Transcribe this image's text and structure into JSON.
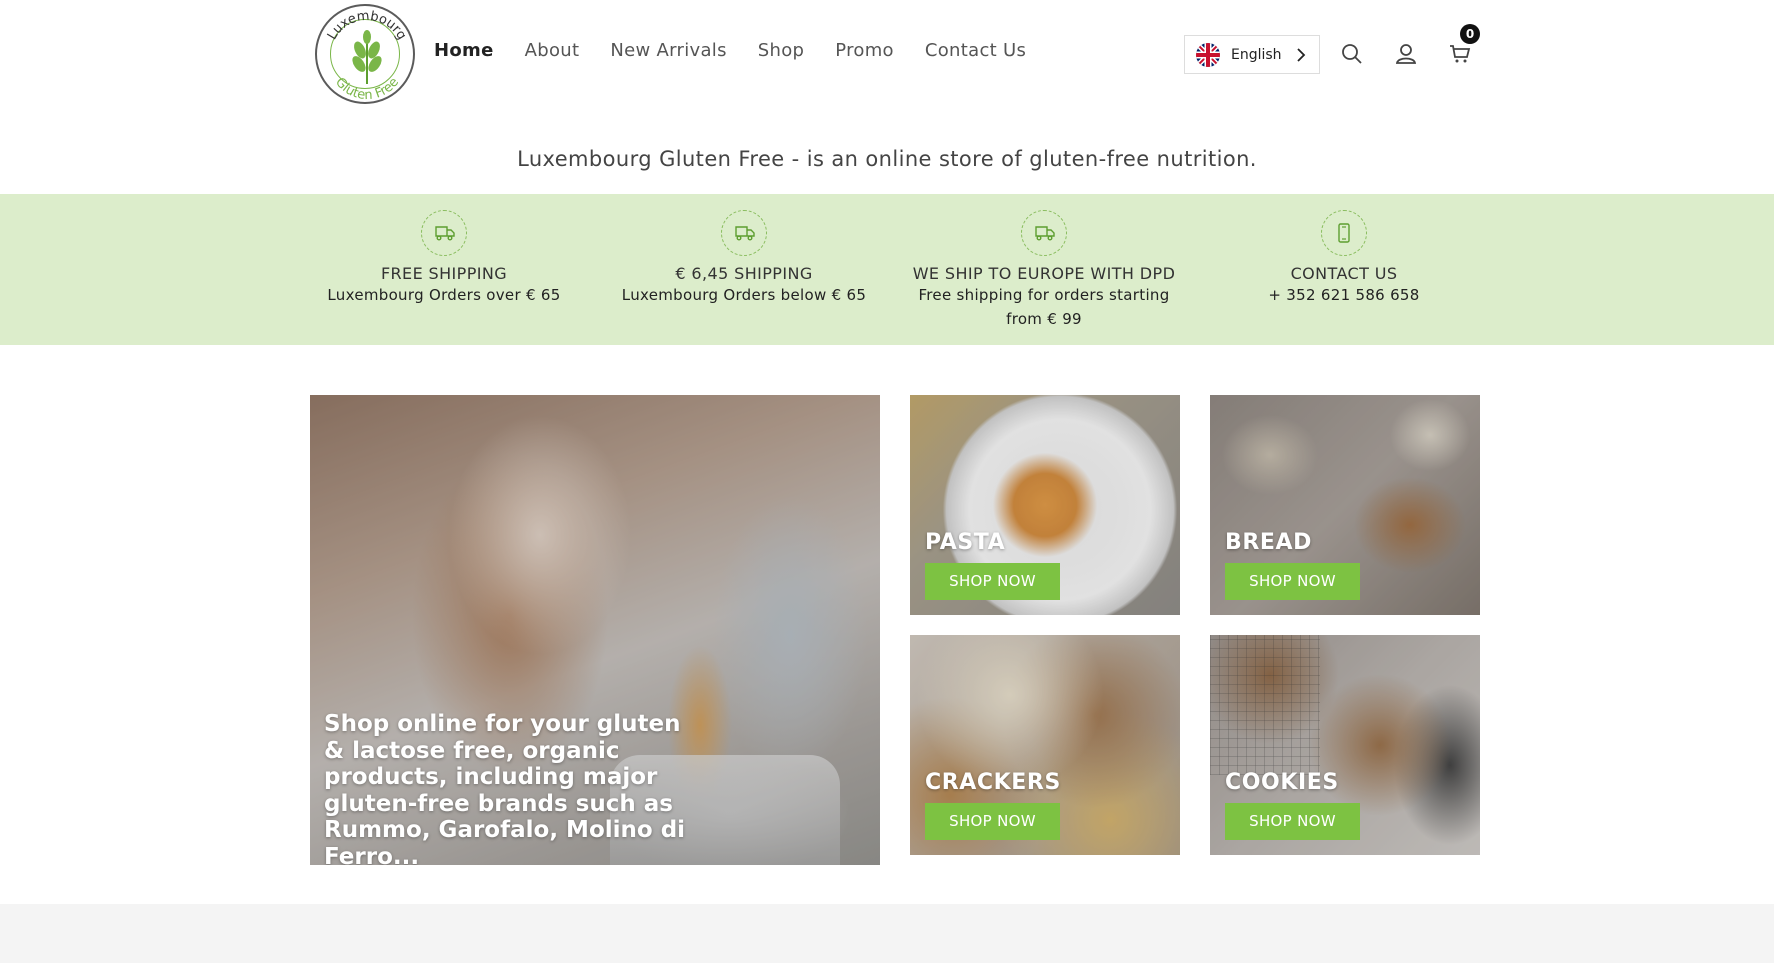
{
  "brand": {
    "logo_top_text": "Luxembourg",
    "logo_bottom_text": "Gluten Free",
    "accent_color": "#7dc242",
    "strip_color": "#dcedcb"
  },
  "nav": {
    "items": [
      {
        "label": "Home",
        "active": true
      },
      {
        "label": "About",
        "active": false
      },
      {
        "label": "New Arrivals",
        "active": false
      },
      {
        "label": "Shop",
        "active": false
      },
      {
        "label": "Promo",
        "active": false
      },
      {
        "label": "Contact Us",
        "active": false
      }
    ]
  },
  "language": {
    "label": "English",
    "flag_icon": "uk-flag-icon",
    "chevron_icon": "chevron-right-icon"
  },
  "header_icons": {
    "search": "search-icon",
    "account": "user-icon",
    "cart": "cart-icon",
    "cart_count": "0"
  },
  "tagline": "Luxembourg Gluten Free - is an online store of gluten-free nutrition.",
  "features": [
    {
      "icon": "truck-icon",
      "title": "FREE SHIPPING",
      "line1": "Luxembourg Orders over € 65",
      "line2": ""
    },
    {
      "icon": "truck-icon",
      "title": "€ 6,45 SHIPPING",
      "line1": "Luxembourg Orders below € 65",
      "line2": ""
    },
    {
      "icon": "truck-icon",
      "title": "WE SHIP TO EUROPE WITH DPD",
      "line1": "Free shipping for orders starting",
      "line2": "from € 99"
    },
    {
      "icon": "phone-icon",
      "title": "CONTACT US",
      "line1": "+ 352 621 586 658",
      "line2": ""
    }
  ],
  "hero": {
    "text": "Shop online for your gluten & lactose free, organic products, including major gluten-free brands such as Rummo, Garofalo, Molino di Ferro..."
  },
  "categories": [
    {
      "title": "PASTA",
      "button": "SHOP NOW"
    },
    {
      "title": "BREAD",
      "button": "SHOP NOW"
    },
    {
      "title": "CRACKERS",
      "button": "SHOP NOW"
    },
    {
      "title": "COOKIES",
      "button": "SHOP NOW"
    }
  ]
}
